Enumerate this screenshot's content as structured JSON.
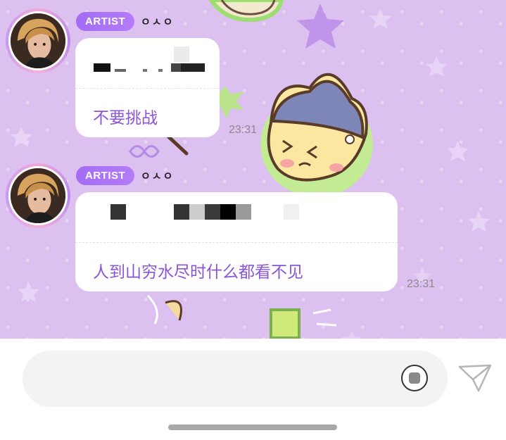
{
  "messages": [
    {
      "badge": "ARTIST",
      "sender": "ㅇㅅㅇ",
      "translation": "不要挑战",
      "time": "23:31"
    },
    {
      "badge": "ARTIST",
      "sender": "ㅇㅅㅇ",
      "translation": "人到山穷水尽时什么都看不见",
      "time": "23:31"
    }
  ],
  "composer": {
    "input_value": "",
    "media_icon": "media-circle-icon",
    "send_icon": "paper-plane-icon"
  },
  "theme": {
    "accent": "#8b55d8",
    "badge": "#a46cf5",
    "background": "#dcc0f0"
  }
}
